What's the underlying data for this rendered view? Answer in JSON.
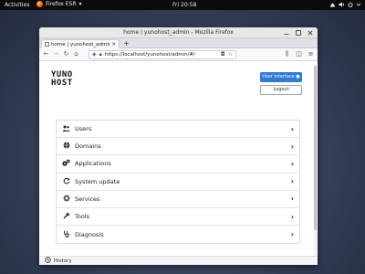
{
  "topbar": {
    "activities": "Activities",
    "app_name": "Firefox ESR",
    "app_menu_arrow": "▾",
    "clock": "Fri 20:58",
    "status_icons": [
      "network-icon",
      "volume-icon",
      "power-icon",
      "chevron-down-icon"
    ]
  },
  "window": {
    "title": "home | yunohost_admin - Mozilla Firefox",
    "controls": [
      "minimize",
      "maximize",
      "close"
    ]
  },
  "tabs": [
    {
      "label": "home | yunohost_admin",
      "active": true
    }
  ],
  "navbar": {
    "url": "https://localhost/yunohost/admin/#/"
  },
  "page": {
    "logo_line1": "YUNO",
    "logo_line2": "HOST",
    "user_interface_label": "User interface",
    "logout_label": "Logout",
    "menu": [
      {
        "label": "Users",
        "icon": "users-icon"
      },
      {
        "label": "Domains",
        "icon": "globe-icon"
      },
      {
        "label": "Applications",
        "icon": "apps-icon"
      },
      {
        "label": "System update",
        "icon": "refresh-icon"
      },
      {
        "label": "Services",
        "icon": "services-icon"
      },
      {
        "label": "Tools",
        "icon": "wrench-icon"
      },
      {
        "label": "Diagnosis",
        "icon": "stethoscope-icon"
      }
    ],
    "history_label": "History"
  },
  "colors": {
    "accent": "#2f7bd8",
    "topbar": "#0b0b0b"
  }
}
